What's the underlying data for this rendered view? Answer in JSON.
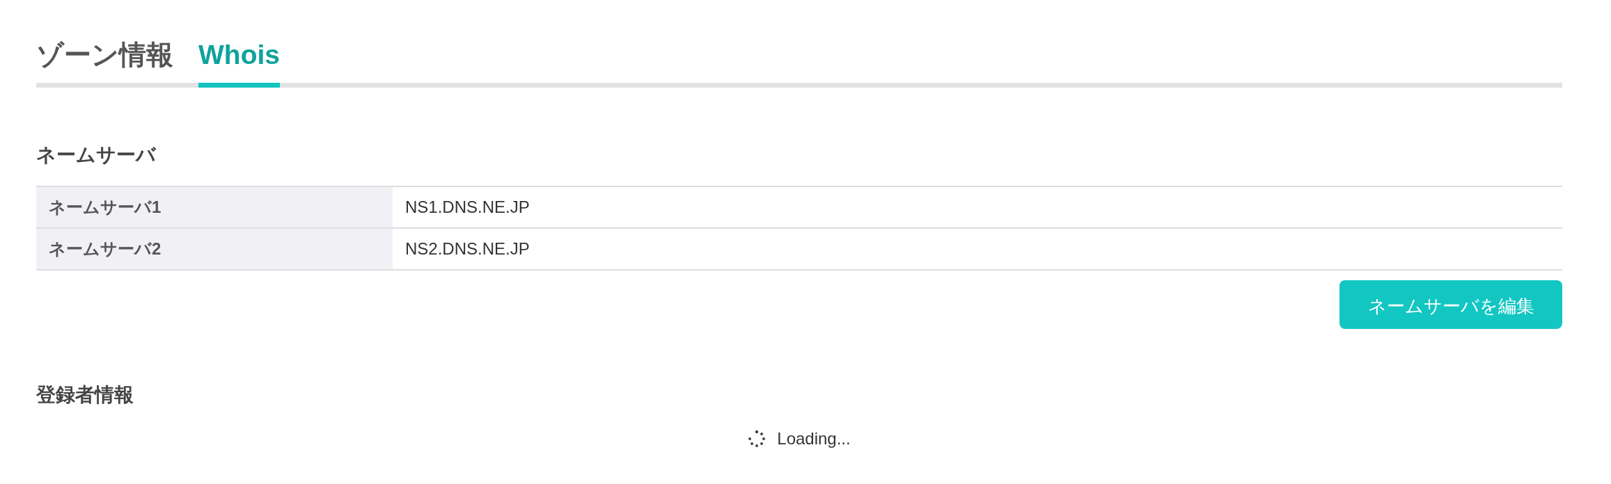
{
  "tabs": [
    {
      "label": "ゾーン情報",
      "selected": false
    },
    {
      "label": "Whois",
      "selected": true
    }
  ],
  "nameserver_section": {
    "heading": "ネームサーバ",
    "rows": [
      {
        "label": "ネームサーバ1",
        "value": "NS1.DNS.NE.JP"
      },
      {
        "label": "ネームサーバ2",
        "value": "NS2.DNS.NE.JP"
      }
    ],
    "button": "ネームサーバを編集"
  },
  "registrant_section": {
    "heading": "登録者情報",
    "loading": "Loading..."
  }
}
